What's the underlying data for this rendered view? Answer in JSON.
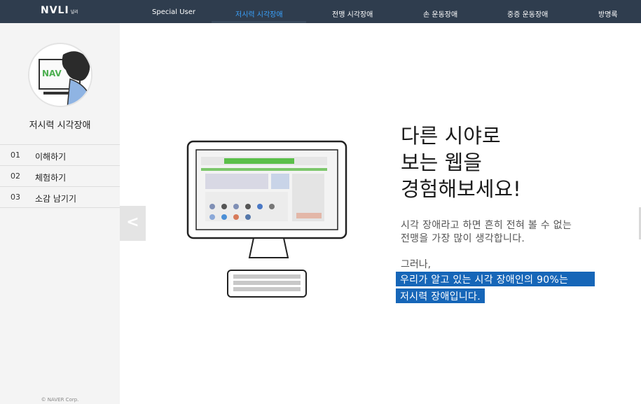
{
  "header": {
    "logo": "NVLI",
    "logo_sub": "널리",
    "nav": [
      {
        "label": "Special User",
        "active": false
      },
      {
        "label": "저시력 시각장애",
        "active": true
      },
      {
        "label": "전맹 시각장애",
        "active": false
      },
      {
        "label": "손 운동장애",
        "active": false
      },
      {
        "label": "중증 운동장애",
        "active": false
      },
      {
        "label": "방명록",
        "active": false
      }
    ]
  },
  "sidebar": {
    "title": "저시력 시각장애",
    "avatar_text": "NAV",
    "items": [
      {
        "num": "01",
        "label": "이해하기"
      },
      {
        "num": "02",
        "label": "체험하기"
      },
      {
        "num": "03",
        "label": "소감 남기기"
      }
    ],
    "copyright": "© NAVER Corp."
  },
  "main": {
    "prev_icon": "<",
    "headline": [
      "다른 시야로",
      "보는 웹을",
      "경험해보세요!"
    ],
    "desc": [
      "시각 장애라고 하면 흔히 전혀 볼 수 없는",
      "전맹을 가장 많이 생각합니다."
    ],
    "but": "그러나,",
    "highlight1": "우리가 알고 있는 시각 장애인의 90%는",
    "highlight2": "저시력 장애입니다."
  },
  "colors": {
    "topbar": "#2f3d4e",
    "active_nav": "#3aa3ff",
    "highlight": "#1666b8"
  }
}
